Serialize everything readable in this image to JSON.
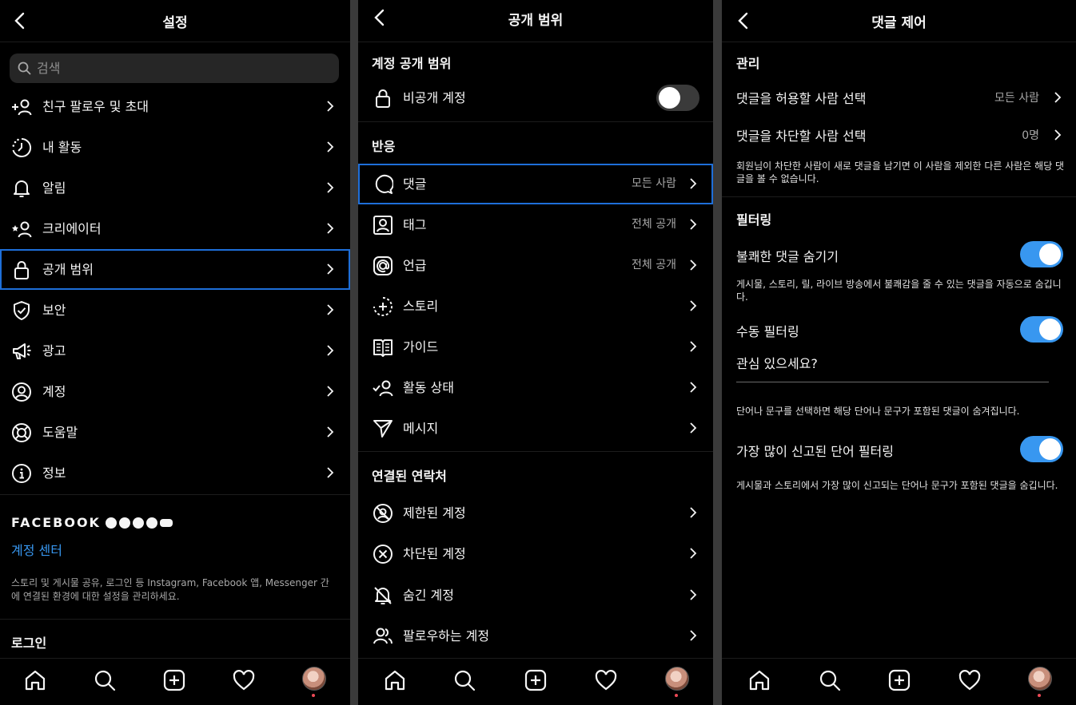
{
  "panel1": {
    "title": "설정",
    "search_placeholder": "검색",
    "menu": [
      {
        "label": "친구 팔로우 및 초대",
        "icon": "add-person-icon"
      },
      {
        "label": "내 활동",
        "icon": "activity-icon"
      },
      {
        "label": "알림",
        "icon": "bell-icon"
      },
      {
        "label": "크리에이터",
        "icon": "creator-icon"
      },
      {
        "label": "공개 범위",
        "icon": "lock-icon"
      },
      {
        "label": "보안",
        "icon": "shield-icon"
      },
      {
        "label": "광고",
        "icon": "megaphone-icon"
      },
      {
        "label": "계정",
        "icon": "account-icon"
      },
      {
        "label": "도움말",
        "icon": "lifebuoy-icon"
      },
      {
        "label": "정보",
        "icon": "info-icon"
      }
    ],
    "facebook_label": "FACEBOOK",
    "accounts_center": "계정 센터",
    "accounts_note": "스토리 및 게시물 공유, 로그인 등 Instagram, Facebook 앱, Messenger 간 에 연결된 환경에 대한 설정을 관리하세요.",
    "login_label": "로그인"
  },
  "panel2": {
    "title": "공개 범위",
    "section_account": "계정 공개 범위",
    "private_account": "비공개 계정",
    "private_on": false,
    "section_interactions": "반응",
    "interactions": [
      {
        "label": "댓글",
        "value": "모든 사람",
        "icon": "comment-icon"
      },
      {
        "label": "태그",
        "value": "전체 공개",
        "icon": "tag-icon"
      },
      {
        "label": "언급",
        "value": "전체 공개",
        "icon": "at-icon"
      },
      {
        "label": "스토리",
        "value": "",
        "icon": "story-add-icon"
      },
      {
        "label": "가이드",
        "value": "",
        "icon": "guide-icon"
      },
      {
        "label": "활동 상태",
        "value": "",
        "icon": "activity-status-icon"
      },
      {
        "label": "메시지",
        "value": "",
        "icon": "send-icon"
      }
    ],
    "section_connections": "연결된 연락처",
    "connections": [
      {
        "label": "제한된 계정",
        "icon": "restricted-icon"
      },
      {
        "label": "차단된 계정",
        "icon": "blocked-icon"
      },
      {
        "label": "숨긴 계정",
        "icon": "muted-icon"
      },
      {
        "label": "팔로우하는 계정",
        "icon": "following-icon"
      }
    ]
  },
  "panel3": {
    "title": "댓글 제어",
    "section_manage": "관리",
    "allow_label": "댓글을 허용할 사람 선택",
    "allow_value": "모든 사람",
    "block_label": "댓글을 차단할 사람 선택",
    "block_value": "0명",
    "block_note": "회원님이 차단한 사람이 새로 댓글을 남기면 이 사람을 제외한 다른 사람은 해당 댓글을 볼 수 없습니다.",
    "section_filter": "필터링",
    "hide_offensive": "불쾌한 댓글 숨기기",
    "hide_offensive_on": true,
    "hide_offensive_note": "게시물, 스토리, 릴, 라이브 방송에서 불쾌감을 줄 수 있는 댓글을 자동으로 숨깁니다.",
    "manual_filter": "수동 필터링",
    "manual_filter_on": true,
    "keyword_placeholder": "관심 있으세요?",
    "manual_note": "단어나 문구를 선택하면 해당 단어나 문구가 포함된 댓글이 숨겨집니다.",
    "most_reported": "가장 많이 신고된 단어 필터링",
    "most_reported_on": true,
    "most_reported_note": "게시물과 스토리에서 가장 많이 신고되는 단어나 문구가 포함된 댓글을 숨깁니다."
  },
  "tabbar": [
    "home-icon",
    "search-icon",
    "new-post-icon",
    "heart-icon",
    "profile-avatar"
  ],
  "colors": {
    "accent": "#3897f0",
    "highlight": "#1e6fd9",
    "notification": "#ed4956"
  }
}
